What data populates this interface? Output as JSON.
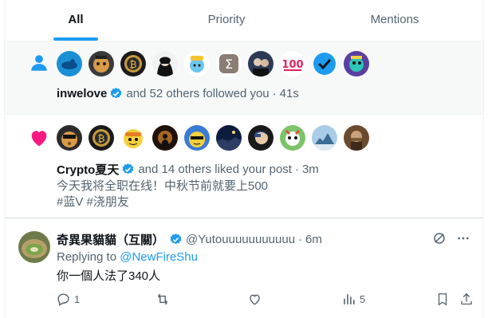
{
  "tabs": [
    {
      "label": "All",
      "active": true
    },
    {
      "label": "Priority",
      "active": false
    },
    {
      "label": "Mentions",
      "active": false
    }
  ],
  "follow_notification": {
    "icon": "person-icon",
    "avatar_count": 10,
    "user": "inwelove",
    "text": "and 52 others followed you",
    "separator": "·",
    "time": "41s"
  },
  "like_notification": {
    "icon": "heart-icon",
    "avatar_count": 10,
    "user": "Crypto夏天",
    "text": "and 14 others liked your post",
    "separator": "·",
    "time": "3m",
    "post_line1": "今天我将全职在线！中秋节前就要上500",
    "post_line2": "#蓝V #浇朋友"
  },
  "reply": {
    "name": "奇異果貓貓（互關）",
    "handle": "@Yutouuuuuuuuuuu",
    "separator": "·",
    "time": "6m",
    "replying_label": "Replying to",
    "replying_to": "@NewFireShu",
    "text": "你一個人法了340人",
    "reply_count": "1",
    "retweet_count": "",
    "like_count": "",
    "view_count": "5"
  },
  "colors": {
    "accent": "#1d9bf0",
    "like": "#f91880",
    "text": "#0f1419",
    "muted": "#536471"
  }
}
